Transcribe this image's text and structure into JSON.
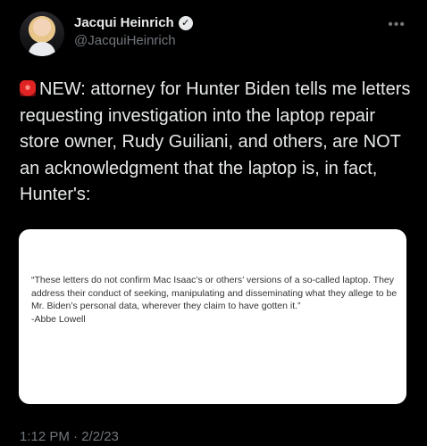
{
  "author": {
    "display_name": "Jacqui Heinrich",
    "handle": "@JacquiHeinrich",
    "verified": true,
    "avatar": "profile-photo"
  },
  "tweet": {
    "icon": "siren-icon",
    "text": "NEW: attorney for Hunter Biden tells me letters requesting investigation into the laptop repair store owner, Rudy Guiliani, and others, are NOT an acknowledgment that the laptop is, in fact, Hunter's:"
  },
  "image_card": {
    "quote": "“These letters do not confirm Mac Isaac’s or others’ versions of a so-called laptop.  They address their conduct of seeking, manipulating and disseminating what they allege to be Mr. Biden’s personal data, wherever they claim to have gotten it.”",
    "attribution": "-Abbe Lowell"
  },
  "meta": {
    "timestamp": "1:12 PM · 2/2/23"
  },
  "colors": {
    "background": "#000000",
    "text": "#e7e9ea",
    "secondary": "#71767b"
  }
}
